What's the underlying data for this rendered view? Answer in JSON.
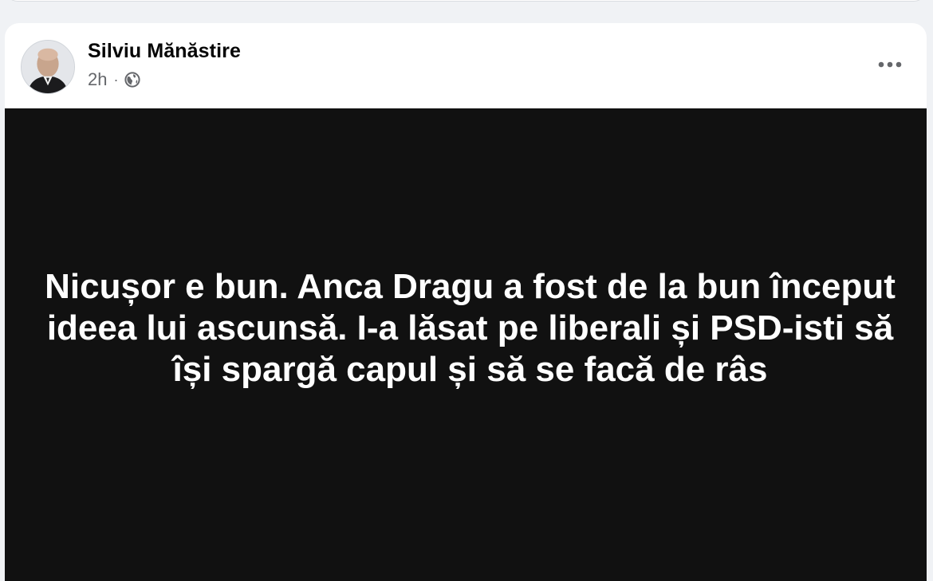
{
  "post": {
    "author": "Silviu Mănăstire",
    "time": "2h",
    "separator": "·",
    "audience_icon": "globe-icon",
    "more_icon": "more-options-icon",
    "text": "Nicușor e bun. Anca Dragu a fost de la bun început ideea lui ascunsă. I-a lăsat pe liberali și PSD-isti să își spargă capul și să se facă de râs",
    "media_background": "#111111",
    "text_color": "#ffffff"
  }
}
